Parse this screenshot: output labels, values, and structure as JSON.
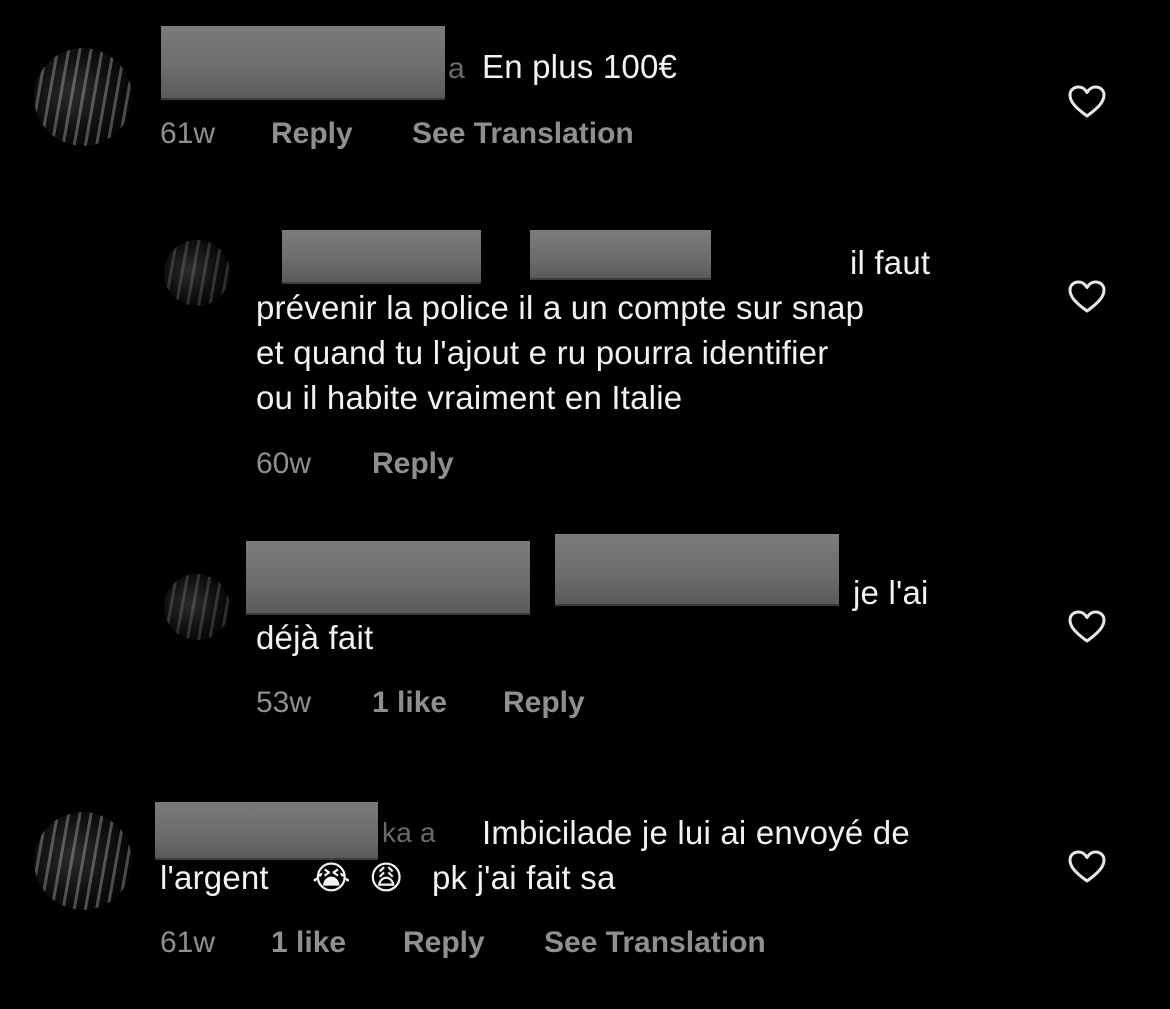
{
  "comments": [
    {
      "text": "En plus 100€",
      "time": "61w",
      "reply": "Reply",
      "translation": "See Translation",
      "heart_icon": "heart-outline-icon"
    },
    {
      "text_line1": "il faut",
      "text_rest": "prévenir la police il a un compte sur snap\net quand tu l'ajout e ru pourra identifier\nou il habite vraiment en Italie",
      "time": "60w",
      "reply": "Reply",
      "heart_icon": "heart-outline-icon"
    },
    {
      "text_line1": "je l'ai",
      "text_rest": "déjà fait",
      "time": "53w",
      "likes": "1 like",
      "reply": "Reply",
      "heart_icon": "heart-outline-icon"
    },
    {
      "text_line1": "Imbicilade je lui ai envoyé de",
      "text_line2_prefix": "l'argent",
      "emoji1": "😭",
      "emoji2": "😩",
      "text_line2_suffix": "pk j'ai fait sa",
      "time": "61w",
      "likes": "1 like",
      "reply": "Reply",
      "translation": "See Translation",
      "heart_icon": "heart-outline-icon"
    }
  ],
  "colors": {
    "background": "#000000",
    "text": "#f2f2f2",
    "meta": "#8f8f8f",
    "redaction": "#6c6c6c"
  }
}
